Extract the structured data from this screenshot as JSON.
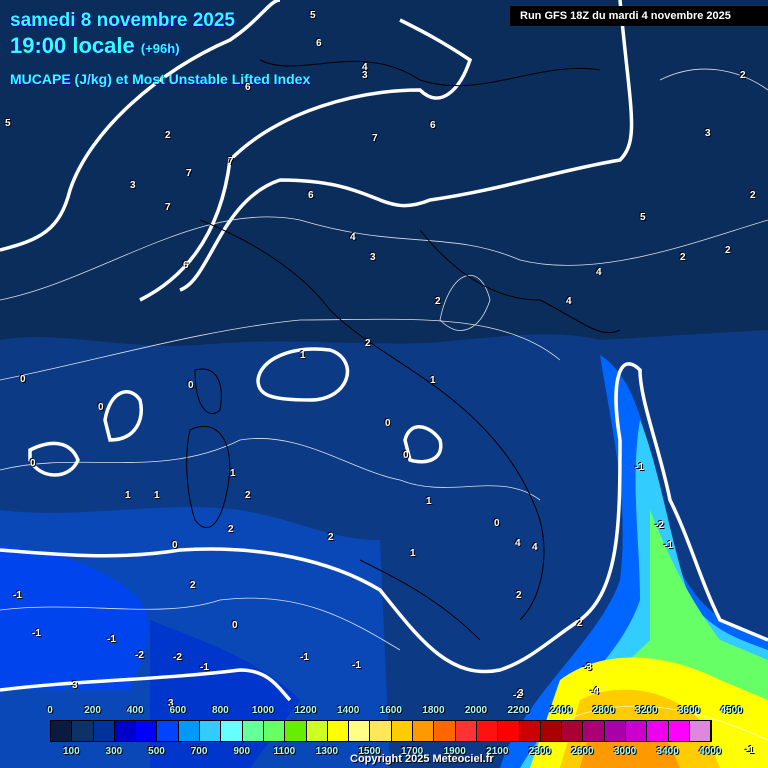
{
  "header": {
    "date": "samedi 8 novembre 2025",
    "time": "19:00 locale",
    "lead": "(+96h)",
    "parameter": "MUCAPE (J/kg) et Most Unstable Lifted Index",
    "run": "Run GFS 18Z du mardi 4 novembre 2025"
  },
  "legend": {
    "unit": "J/kg",
    "colors": [
      "#0a1a40",
      "#0d3366",
      "#003399",
      "#0000cc",
      "#0000ff",
      "#0044ff",
      "#0099ff",
      "#33ccff",
      "#66ffff",
      "#66ff99",
      "#66ff66",
      "#66ee00",
      "#ccff22",
      "#ffff00",
      "#ffff88",
      "#ffe855",
      "#ffcc00",
      "#ff9900",
      "#ff6600",
      "#ff3333",
      "#ff1111",
      "#ff0000",
      "#cc0000",
      "#aa0000",
      "#aa0033",
      "#aa0077",
      "#aa00aa",
      "#cc00cc",
      "#ee00ee",
      "#ff00ff",
      "#dd88dd",
      "#ffccff",
      "#ffffff"
    ],
    "top_labels": [
      "0",
      "200",
      "400",
      "600",
      "800",
      "1000",
      "1200",
      "1400",
      "1600",
      "1800",
      "2000",
      "2200",
      "2400",
      "2800",
      "3200",
      "3600",
      "4500"
    ],
    "bottom_labels": [
      "100",
      "300",
      "500",
      "700",
      "900",
      "1100",
      "1300",
      "1500",
      "1700",
      "1900",
      "2100",
      "2300",
      "2600",
      "3000",
      "3400",
      "4000"
    ]
  },
  "contour_labels": [
    "5",
    "6",
    "6",
    "4",
    "3",
    "7",
    "6",
    "2",
    "7",
    "7",
    "3",
    "7",
    "6",
    "5",
    "6",
    "4",
    "3",
    "2",
    "4",
    "4",
    "5",
    "2",
    "2",
    "3",
    "2",
    "2",
    "1",
    "0",
    "0",
    "0",
    "0",
    "0",
    "0",
    "1",
    "1",
    "1",
    "2",
    "2",
    "2",
    "1",
    "0",
    "0",
    "1",
    "-1",
    "-1",
    "-1",
    "-2",
    "-2",
    "-1",
    "-1",
    "-1",
    "-2",
    "-3",
    "-4",
    "0",
    "-1",
    "-2",
    "-1",
    "3",
    "3",
    "4",
    "2",
    "2",
    "3",
    "2",
    "2",
    "1",
    "4",
    "-1"
  ],
  "copyright": "Copyright 2025 Meteociel.fr"
}
